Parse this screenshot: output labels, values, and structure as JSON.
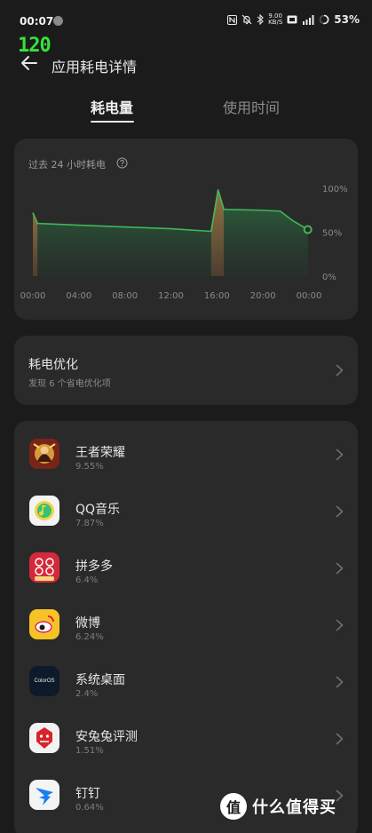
{
  "status_bar": {
    "time": "00:07",
    "net_speed_value": "9.00",
    "net_speed_unit": "KB/S",
    "battery": "53%"
  },
  "fps_overlay": "120",
  "header": {
    "title": "应用耗电详情"
  },
  "tabs": [
    {
      "label": "耗电量",
      "active": true
    },
    {
      "label": "使用时间",
      "active": false
    }
  ],
  "chart_card": {
    "title": "过去 24 小时耗电",
    "chart_data": {
      "type": "area",
      "title": "过去 24 小时耗电",
      "x_ticks": [
        "00:00",
        "04:00",
        "08:00",
        "12:00",
        "16:00",
        "20:00",
        "00:00"
      ],
      "y_ticks": [
        "100%",
        "50%",
        "0%"
      ],
      "ylim": [
        0,
        100
      ],
      "xlim_hours": [
        0,
        24
      ],
      "series": [
        {
          "color": "#3fb65a",
          "points": [
            {
              "x": 0.0,
              "y": 72
            },
            {
              "x": 0.4,
              "y": 60
            },
            {
              "x": 4.0,
              "y": 58
            },
            {
              "x": 8.0,
              "y": 56
            },
            {
              "x": 12.0,
              "y": 54
            },
            {
              "x": 15.5,
              "y": 51
            },
            {
              "x": 16.1,
              "y": 98
            },
            {
              "x": 16.6,
              "y": 76
            },
            {
              "x": 20.0,
              "y": 75
            },
            {
              "x": 21.5,
              "y": 74
            },
            {
              "x": 22.5,
              "y": 64
            },
            {
              "x": 23.9,
              "y": 53
            }
          ]
        }
      ],
      "charging_segments": [
        {
          "start": 0.0,
          "end": 0.4
        },
        {
          "start": 15.5,
          "end": 16.6
        }
      ],
      "charging_color": "#e07a45",
      "grid": false
    }
  },
  "optimize": {
    "title": "耗电优化",
    "subtitle": "发现 6 个省电优化项"
  },
  "apps": [
    {
      "name": "王者荣耀",
      "pct": "9.55%",
      "icon": "honor-of-kings-icon"
    },
    {
      "name": "QQ音乐",
      "pct": "7.87%",
      "icon": "qq-music-icon"
    },
    {
      "name": "拼多多",
      "pct": "6.4%",
      "icon": "pinduoduo-icon"
    },
    {
      "name": "微博",
      "pct": "6.24%",
      "icon": "weibo-icon"
    },
    {
      "name": "系统桌面",
      "pct": "2.4%",
      "icon": "coloros-launcher-icon",
      "icon_text": "ColorOS"
    },
    {
      "name": "安兔兔评测",
      "pct": "1.51%",
      "icon": "antutu-icon"
    },
    {
      "name": "钉钉",
      "pct": "0.64%",
      "icon": "dingtalk-icon"
    }
  ],
  "watermark": {
    "logo_text": "值",
    "text": "什么值得买"
  },
  "colors": {
    "background": "#1b1b1b",
    "card": "#2a2a2a",
    "accent_green": "#3fb65a",
    "charging_orange": "#e07a45"
  }
}
